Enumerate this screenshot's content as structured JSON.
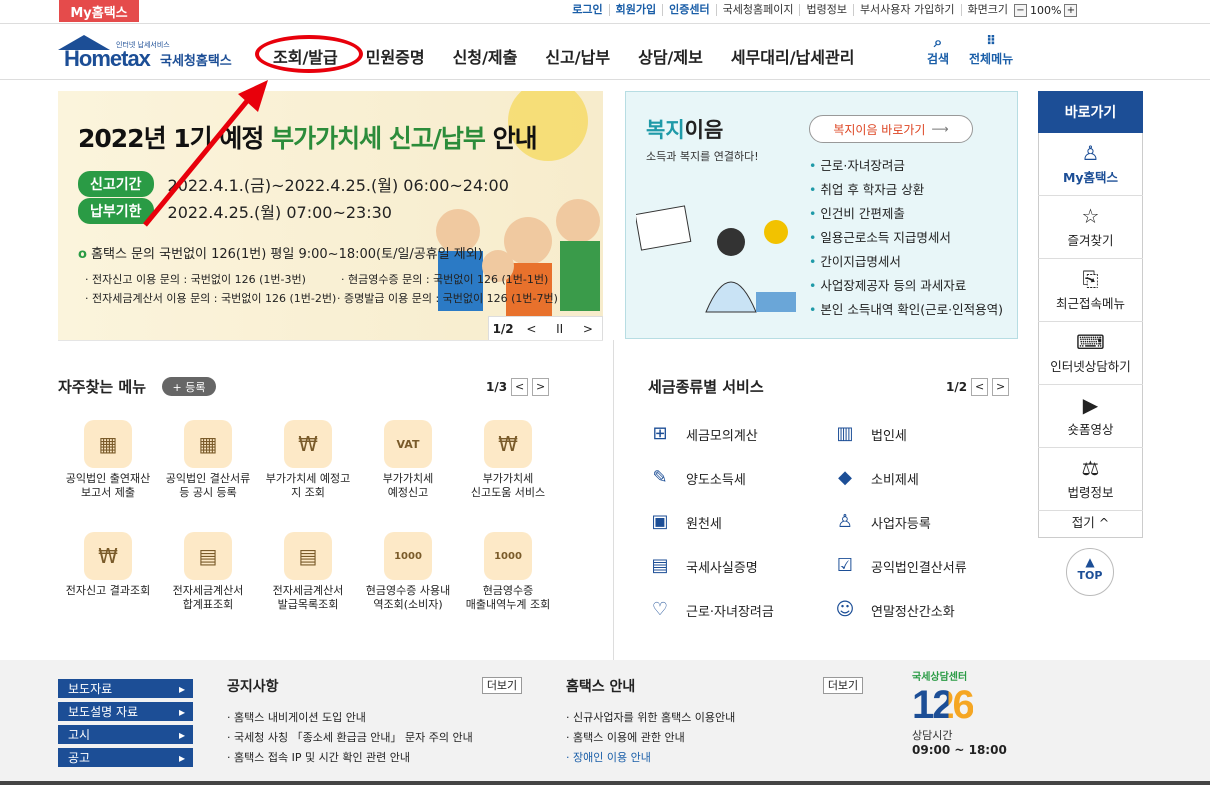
{
  "topbar": {
    "my_label": "My홈택스",
    "links": [
      "로그인",
      "회원가입",
      "인증센터",
      "국세청홈페이지",
      "법령정보",
      "부서사용자 가입하기",
      "화면크기"
    ],
    "zoom_value": "100%",
    "zoom_minus": "−",
    "zoom_plus": "+"
  },
  "header": {
    "logo_small": "인터넷 납세서비스",
    "logo_main": "Hometax",
    "logo_kor": "국세청홈택스",
    "nav": [
      "조회/발급",
      "민원증명",
      "신청/제출",
      "신고/납부",
      "상담/제보",
      "세무대리/납세관리"
    ],
    "search_label": "검색",
    "allmenu_label": "전체메뉴"
  },
  "banner": {
    "title_pre": "2022년 1기 예정 ",
    "title_hl": "부가가치세 신고/납부",
    "title_post": " 안내",
    "period1_label": "신고기간",
    "period1": "2022.4.1.(금)~2022.4.25.(월) 06:00~24:00",
    "period2_label": "납부기한",
    "period2": "2022.4.25.(월) 07:00~23:30",
    "qa": "홈택스 문의 국번없이 126(1번) 평일 9:00~18:00(토/일/공휴일 제외)",
    "qa_dot": "o",
    "line1a": "· 전자신고 이용 문의 : 국번없이 126 (1번-3번)",
    "line1b": "· 현금영수증 문의 : 국번없이 126 (1번-1번)",
    "line2a": "· 전자세금계산서 이용 문의 : 국번없이 126 (1번-2번)",
    "line2b": "· 증명발급 이용 문의 : 국번없이 126 (1번-7번)",
    "page": "1/2",
    "prev": "<",
    "pause": "II",
    "next": ">"
  },
  "welfare": {
    "title_a": "복지",
    "title_b": "이음",
    "sub": "소득과 복지를 연결하다!",
    "button": "복지이음 바로가기",
    "items": [
      "근로·자녀장려금",
      "취업 후 학자금 상환",
      "인건비 간편제출",
      "일용근로소득 지급명세서",
      "간이지급명세서",
      "사업장제공자 등의 과세자료",
      "본인 소득내역 확인(근로·인적용역)"
    ]
  },
  "quick": {
    "title": "바로가기",
    "items": [
      "My홈택스",
      "즐겨찾기",
      "최근접속메뉴",
      "인터넷상담하기",
      "숏폼영상",
      "법령정보"
    ],
    "fold": "접기 ^",
    "top": "TOP"
  },
  "favorites": {
    "title": "자주찾는 메뉴",
    "register": "+ 등록",
    "page": "1/3",
    "items": [
      [
        "공익법인 출연재산",
        "보고서 제출"
      ],
      [
        "공익법인 결산서류",
        "등 공시 등록"
      ],
      [
        "부가가치세 예정고",
        "지 조회"
      ],
      [
        "부가가치세",
        "예정신고"
      ],
      [
        "부가가치세",
        "신고도움 서비스"
      ],
      [
        "전자신고 결과조회",
        ""
      ],
      [
        "전자세금계산서",
        "합계표조회"
      ],
      [
        "전자세금계산서",
        "발급목록조회"
      ],
      [
        "현금영수증 사용내",
        "역조회(소비자)"
      ],
      [
        "현금영수증",
        "매출내역누계 조회"
      ]
    ]
  },
  "taxservice": {
    "title": "세금종류별 서비스",
    "page": "1/2",
    "items": [
      "세금모의계산",
      "법인세",
      "양도소득세",
      "소비제세",
      "원천세",
      "사업자등록",
      "국세사실증명",
      "공익법인결산서류",
      "근로·자녀장려금",
      "연말정산간소화"
    ]
  },
  "footer": {
    "buttons": [
      "보도자료",
      "보도설명 자료",
      "고시",
      "공고"
    ],
    "notice_title": "공지사항",
    "notice_more": "더보기",
    "notices": [
      "홈택스 내비게이션 도입 안내",
      "국세청 사칭 「종소세 환급금 안내」 문자 주의 안내",
      "홈택스 접속 IP 및 시간 확인 관련 안내"
    ],
    "guide_title": "홈택스 안내",
    "guide_more": "더보기",
    "guides": [
      "신규사업자를 위한 홈택스 이용안내",
      "홈택스 이용에 관한 안내",
      "장애인 이용 안내"
    ],
    "center_label": "국세상담센터",
    "center_num": "126",
    "hours_label": "상담시간",
    "hours": "09:00 ~ 18:00"
  }
}
